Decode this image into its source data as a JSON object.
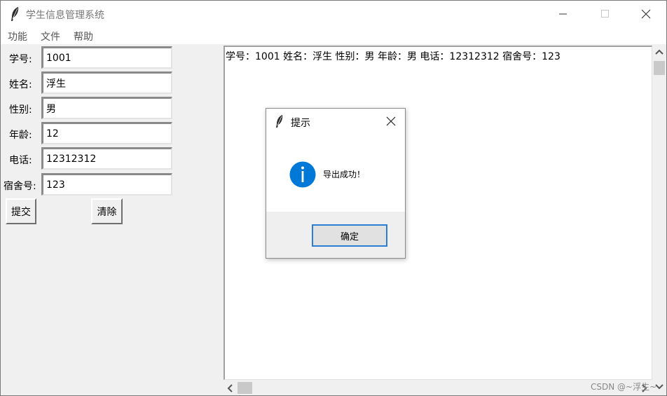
{
  "window": {
    "title": "学生信息管理系统",
    "icon": "feather-icon"
  },
  "menu": {
    "items": [
      "功能",
      "文件",
      "帮助"
    ]
  },
  "form": {
    "fields": [
      {
        "label": "学号:",
        "value": "1001"
      },
      {
        "label": "姓名:",
        "value": "浮生"
      },
      {
        "label": "性别:",
        "value": "男"
      },
      {
        "label": "年龄:",
        "value": "12"
      },
      {
        "label": "电话:",
        "value": "12312312"
      },
      {
        "label": "宿舍号:",
        "value": "123"
      }
    ],
    "submit_label": "提交",
    "clear_label": "清除"
  },
  "output": {
    "line": "学号：1001  姓名：浮生  性别：男  年龄：男  电话：12312312  宿舍号：123"
  },
  "dialog": {
    "title": "提示",
    "icon": "info-icon",
    "message": "导出成功！",
    "ok_label": "确定",
    "accent_color": "#0078d7"
  },
  "watermark": "CSDN @~浮生~"
}
